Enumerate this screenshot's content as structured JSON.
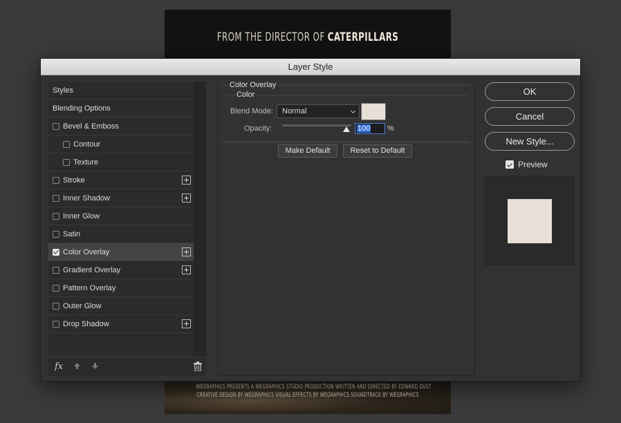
{
  "poster": {
    "title_prefix": "FROM THE DIRECTOR OF",
    "title_name": "CATERPILLARS",
    "credit_line1": "WEGRAPHICS PRESENTS A WEGRAPHICS STUDIO PRODUCTION WRITTEN AND DIRECTED BY EDWARD DUST",
    "credit_line2": "CREATIVE DESIGN BY WEGRAPHICS VISUAL EFFECTS BY WEGRAPHICS SOUNDTRACK BY WEGRAPHICS"
  },
  "dialog": {
    "title": "Layer Style"
  },
  "styles_list": {
    "items": [
      {
        "label": "Styles"
      },
      {
        "label": "Blending Options"
      },
      {
        "label": "Bevel & Emboss"
      },
      {
        "label": "Contour"
      },
      {
        "label": "Texture"
      },
      {
        "label": "Stroke"
      },
      {
        "label": "Inner Shadow"
      },
      {
        "label": "Inner Glow"
      },
      {
        "label": "Satin"
      },
      {
        "label": "Color Overlay",
        "checked": true,
        "selected": true
      },
      {
        "label": "Gradient Overlay"
      },
      {
        "label": "Pattern Overlay"
      },
      {
        "label": "Outer Glow"
      },
      {
        "label": "Drop Shadow"
      }
    ],
    "fx_label": "fx"
  },
  "color_overlay": {
    "section_title": "Color Overlay",
    "group_title": "Color",
    "blend_mode_label": "Blend Mode:",
    "blend_mode_value": "Normal",
    "opacity_label": "Opacity:",
    "opacity_value": "100",
    "opacity_unit": "%",
    "overlay_color": "#e8e0d6",
    "make_default": "Make Default",
    "reset_default": "Reset to Default"
  },
  "actions": {
    "ok": "OK",
    "cancel": "Cancel",
    "new_style": "New Style...",
    "preview_label": "Preview",
    "preview_checked": true
  }
}
